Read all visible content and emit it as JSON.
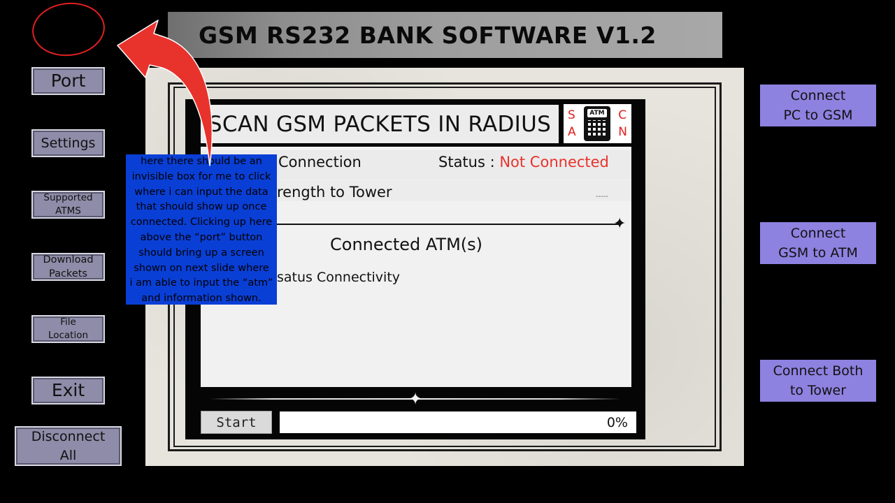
{
  "app": {
    "title": "GSM RS232 BANK SOFTWARE V1.2"
  },
  "sidebar": {
    "port": "Port",
    "settings": "Settings",
    "supported_atms": "Supported\nATMS",
    "download_packets": "Download\nPackets",
    "file_location": "File\nLocation",
    "exit": "Exit",
    "disconnect_all": "Disconnect\nAll"
  },
  "right_actions": {
    "pc_to_gsm": "Connect\nPC to GSM",
    "gsm_to_atm": "Connect\nGSM to ATM",
    "both_to_tower": "Connect Both\nto Tower"
  },
  "panel": {
    "scan_title": "SCAN GSM PACKETS IN RADIUS",
    "logo_letters_left": [
      "S",
      "A"
    ],
    "logo_letters_right": [
      "C",
      "N"
    ],
    "logo_screen": "ATM",
    "connection_label": "Connection",
    "status_label": "Status : ",
    "status_value": "Not Connected",
    "strength_label": "rength to Tower",
    "strength_value": "-----",
    "connected_atms_heading": "Connected ATM(s)",
    "status_connectivity": "satus Connectivity",
    "start_button": "Start",
    "progress_label": "0%",
    "progress_fraction": 0
  },
  "annotation_note": "here there should be an\ninvisible box for me to click\nwhere i can input the data\nthat should show up once\nconnected. Clicking up here\nabove the “port” button\nshould bring up a screen\nshown on next slide where\ni am able to input the “atm”\nand information shown.",
  "colors": {
    "status_error": "#e8322c",
    "note_background": "#0a3fd6",
    "right_buttons": "#8d82e0",
    "sidebar_buttons": "#8e8ca8",
    "arrow": "#e8322c"
  }
}
